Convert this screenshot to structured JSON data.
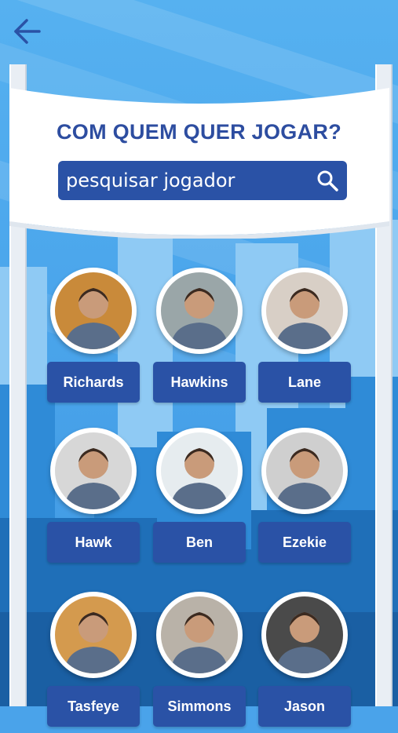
{
  "header": {
    "back_icon": "arrow-left-icon",
    "title": "COM QUEM QUER JOGAR?"
  },
  "search": {
    "placeholder": "pesquisar jogador",
    "icon": "search-icon"
  },
  "players": [
    {
      "name": "Richards",
      "avatar_color": "#c98a3a"
    },
    {
      "name": "Hawkins",
      "avatar_color": "#9aa6a8"
    },
    {
      "name": "Lane",
      "avatar_color": "#d8cfc6"
    },
    {
      "name": "Hawk",
      "avatar_color": "#d7d7d7"
    },
    {
      "name": "Ben",
      "avatar_color": "#e6ecef"
    },
    {
      "name": "Ezekie",
      "avatar_color": "#cfcfcf"
    },
    {
      "name": "Tasfeye",
      "avatar_color": "#d49a4e"
    },
    {
      "name": "Simmons",
      "avatar_color": "#b9b2a8"
    },
    {
      "name": "Jason",
      "avatar_color": "#4a4a4a"
    }
  ],
  "colors": {
    "brand_blue": "#2a52a6",
    "title_blue": "#2d4da0",
    "sky": "#4aa3ea"
  }
}
